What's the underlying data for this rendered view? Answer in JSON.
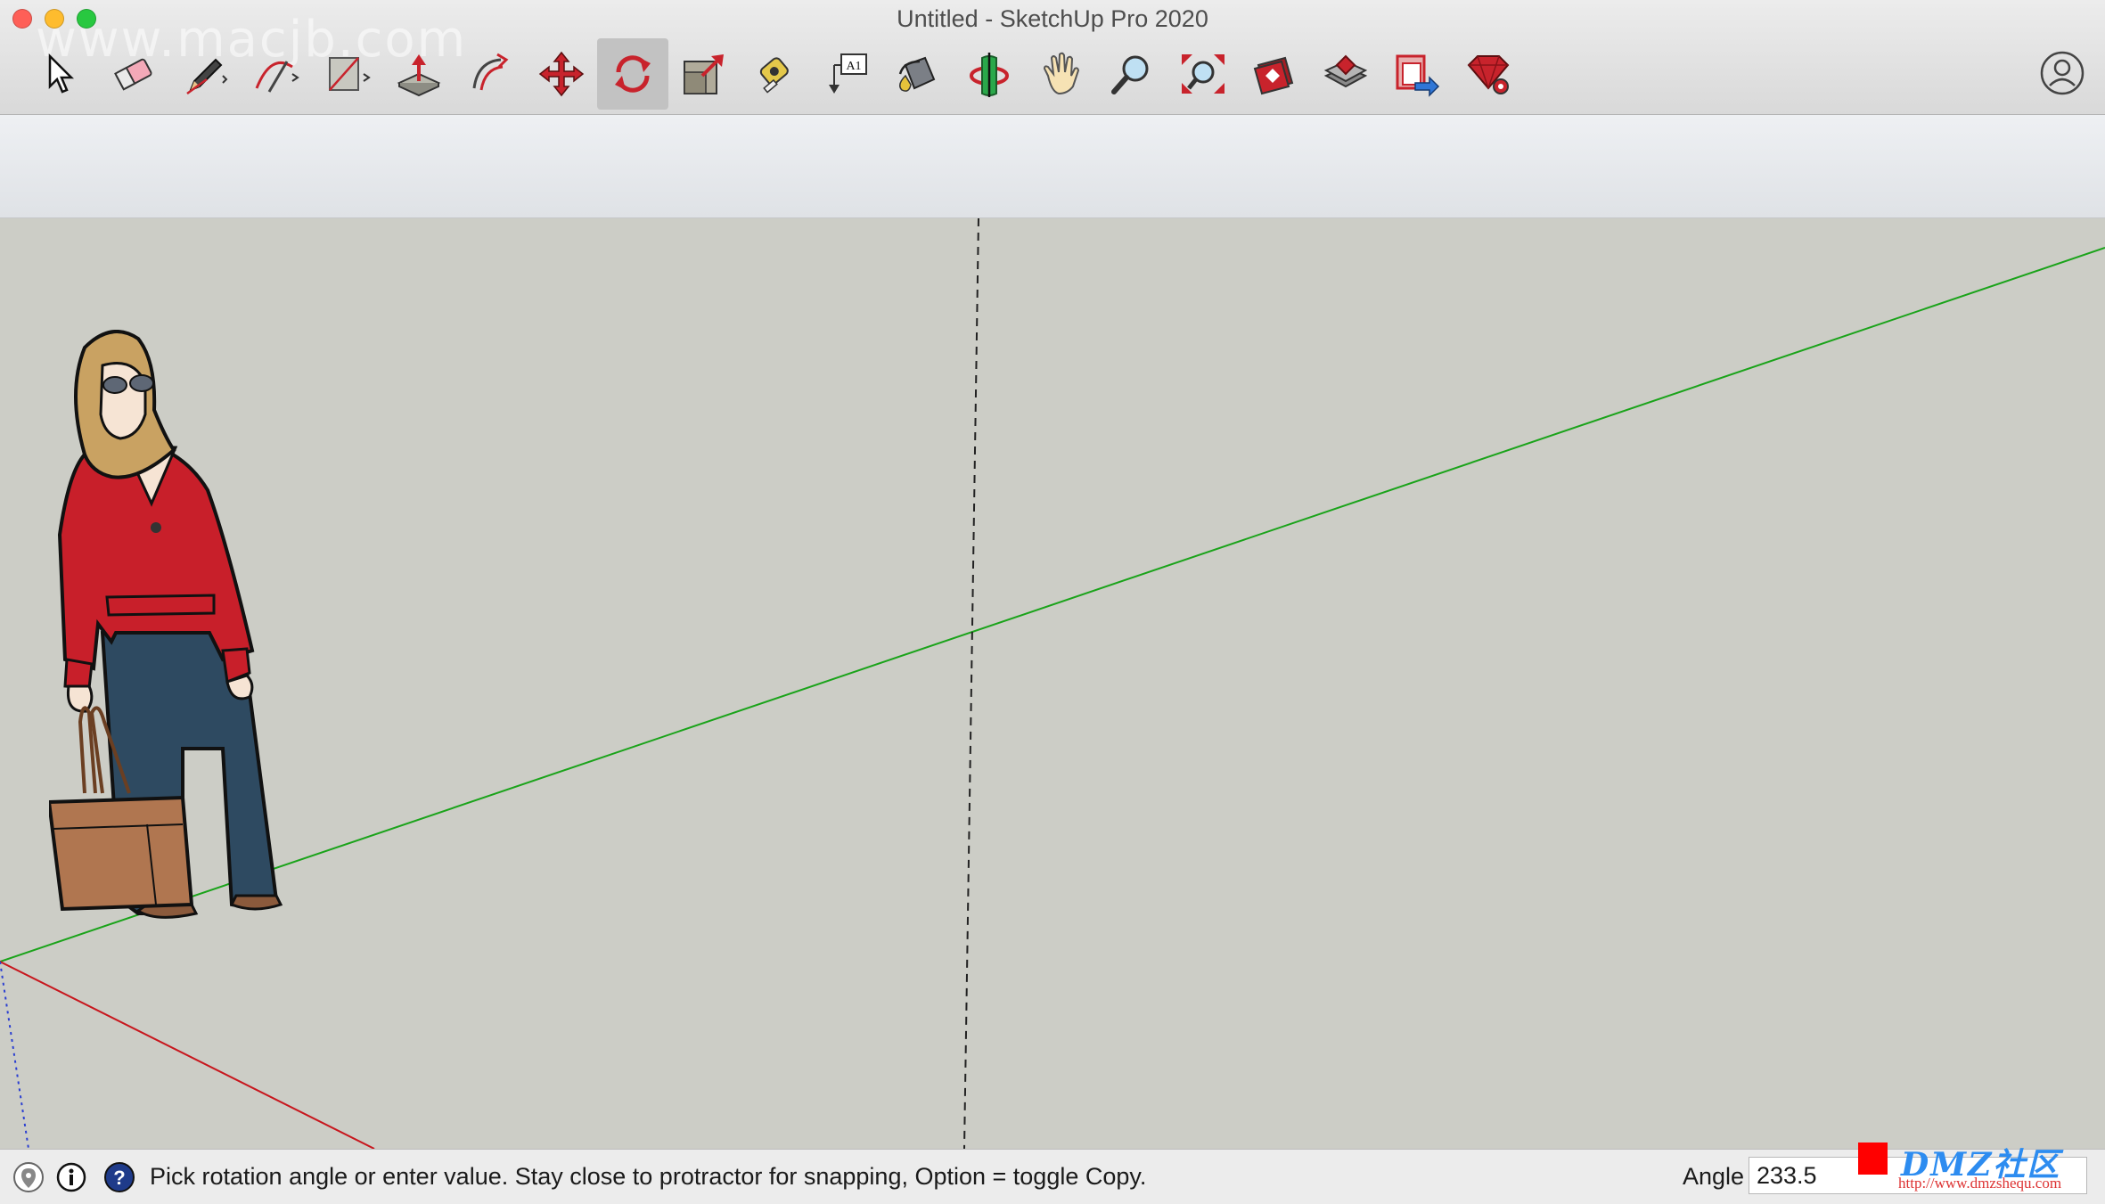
{
  "window": {
    "title": "Untitled - SketchUp Pro 2020",
    "watermark": "www.macjb.com"
  },
  "toolbar": {
    "tools": [
      {
        "name": "Select",
        "icon": "select-arrow-icon"
      },
      {
        "name": "Eraser",
        "icon": "eraser-icon"
      },
      {
        "name": "Line",
        "icon": "pencil-icon"
      },
      {
        "name": "Arc",
        "icon": "arc-icon"
      },
      {
        "name": "Rectangle",
        "icon": "rectangle-icon"
      },
      {
        "name": "Push/Pull",
        "icon": "push-pull-icon"
      },
      {
        "name": "Offset",
        "icon": "offset-icon"
      },
      {
        "name": "Move",
        "icon": "move-icon"
      },
      {
        "name": "Rotate",
        "icon": "rotate-icon",
        "active": true
      },
      {
        "name": "Scale",
        "icon": "scale-icon"
      },
      {
        "name": "Tape Measure",
        "icon": "tape-measure-icon"
      },
      {
        "name": "Text",
        "icon": "text-icon",
        "label": "A1"
      },
      {
        "name": "Paint Bucket",
        "icon": "paint-bucket-icon"
      },
      {
        "name": "Orbit",
        "icon": "orbit-icon"
      },
      {
        "name": "Pan",
        "icon": "pan-hand-icon"
      },
      {
        "name": "Zoom",
        "icon": "zoom-icon"
      },
      {
        "name": "Zoom Extents",
        "icon": "zoom-extents-icon"
      },
      {
        "name": "3D Warehouse",
        "icon": "warehouse-icon"
      },
      {
        "name": "Extension Warehouse",
        "icon": "extension-warehouse-icon"
      },
      {
        "name": "Share Model",
        "icon": "share-model-icon"
      },
      {
        "name": "Extension Manager",
        "icon": "ruby-gear-icon"
      }
    ],
    "profile_icon": "user-profile-icon"
  },
  "colors": {
    "viewport_bg": "#cccdc6",
    "green_axis": "#1aa31a",
    "red_axis": "#c8161d",
    "blue_axis": "#2b3fd1",
    "icon_red": "#c8232c"
  },
  "statusbar": {
    "icons": [
      "geolocation-icon",
      "credits-info-icon",
      "help-icon"
    ],
    "message": "Pick rotation angle or enter value.  Stay close to protractor for snapping, Option = toggle Copy.",
    "measure_label": "Angle",
    "measure_value": "233.5"
  },
  "overlay": {
    "dmz_text": "DMZ社区",
    "dmz_url": "http://www.dmzshequ.com"
  }
}
